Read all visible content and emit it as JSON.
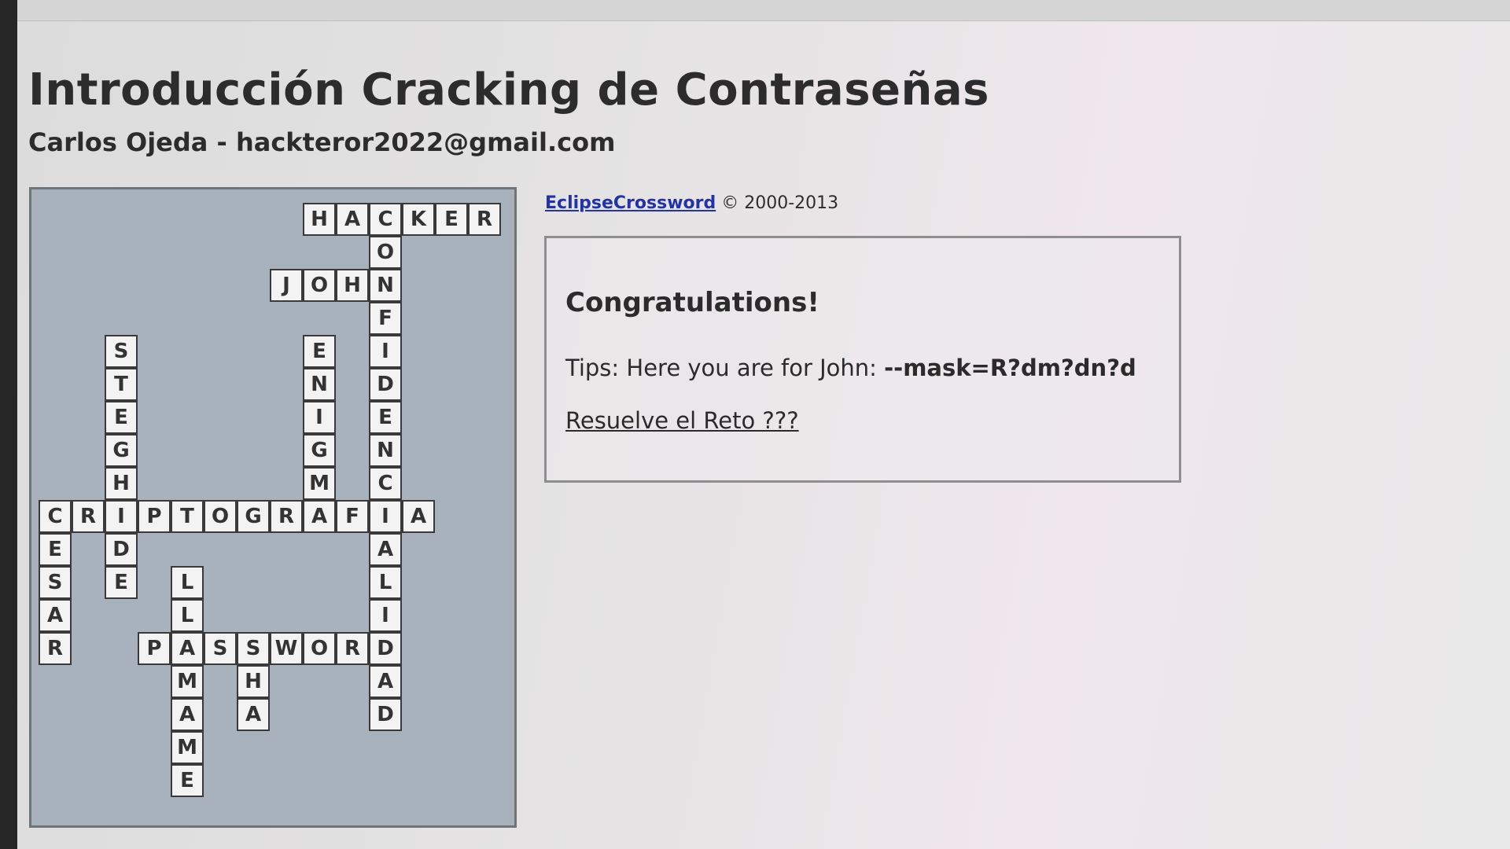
{
  "page": {
    "title": "Introducción Cracking de Contraseñas",
    "subtitle": "Carlos Ojeda - hackteror2022@gmail.com"
  },
  "credit": {
    "link_text": "EclipseCrossword",
    "text": "© 2000-2013"
  },
  "result": {
    "heading": "Congratulations!",
    "tips_prefix": "Tips: Here you are for John: ",
    "tips_mask": "--mask=R?dm?dn?d",
    "link_text": "Resuelve el Reto ???"
  },
  "crossword": {
    "words": [
      {
        "word": "HACKER",
        "row": 0,
        "col": 8,
        "dir": "across"
      },
      {
        "word": "JOHN",
        "row": 2,
        "col": 7,
        "dir": "across"
      },
      {
        "word": "CRIPTOGRAFIA",
        "row": 9,
        "col": 0,
        "dir": "across"
      },
      {
        "word": "PASSWORD",
        "row": 13,
        "col": 3,
        "dir": "across"
      },
      {
        "word": "CONFIDENCIALIDAD",
        "row": 0,
        "col": 10,
        "dir": "down"
      },
      {
        "word": "STEGHIDE",
        "row": 4,
        "col": 2,
        "dir": "down"
      },
      {
        "word": "ENIGMA",
        "row": 4,
        "col": 8,
        "dir": "down"
      },
      {
        "word": "CESAR",
        "row": 9,
        "col": 0,
        "dir": "down"
      },
      {
        "word": "LLAMAME",
        "row": 11,
        "col": 4,
        "dir": "down"
      },
      {
        "word": "SHA",
        "row": 13,
        "col": 6,
        "dir": "down"
      }
    ]
  }
}
